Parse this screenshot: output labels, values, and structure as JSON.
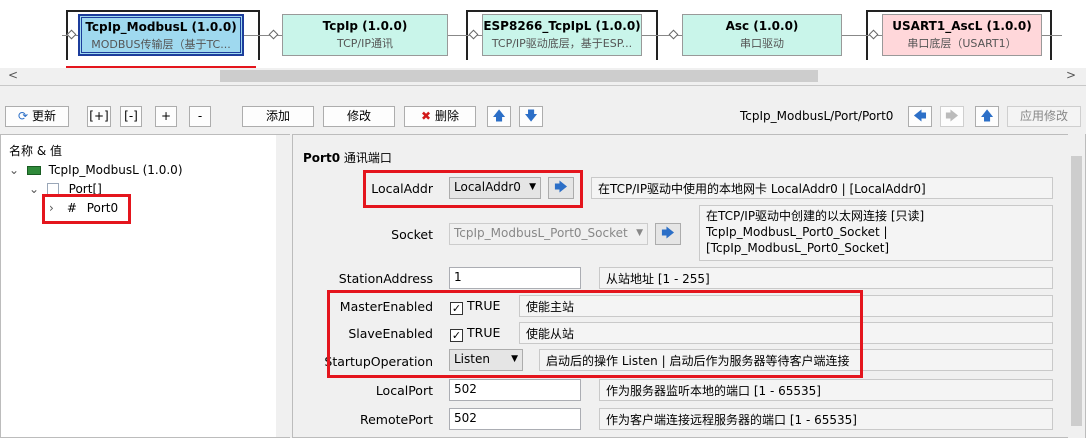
{
  "chain": {
    "nodes": [
      {
        "title": "TcpIp_ModbusL (1.0.0)",
        "sub": "MODBUS传输层（基于TC..."
      },
      {
        "title": "TcpIp (1.0.0)",
        "sub": "TCP/IP通讯"
      },
      {
        "title": "ESP8266_TcpIpL (1.0.0)",
        "sub": "TCP/IP驱动底层，基于ESP..."
      },
      {
        "title": "Asc (1.0.0)",
        "sub": "串口驱动"
      },
      {
        "title": "USART1_AscL (1.0.0)",
        "sub": "串口底层（USART1）"
      }
    ],
    "scroll_left": "<",
    "scroll_right": ">"
  },
  "toolbar": {
    "refresh": "更新",
    "expand": "[+]",
    "collapse": "[-]",
    "plus": "+",
    "minus": "-",
    "add": "添加",
    "modify": "修改",
    "delete": "删除",
    "path": "TcpIp_ModbusL/Port/Port0",
    "apply": "应用修改"
  },
  "tree": {
    "header": "名称 & 值",
    "root": "TcpIp_ModbusL (1.0.0)",
    "port": "Port[]",
    "port0": "Port0"
  },
  "panel": {
    "title_bold": "Port0",
    "title_rest": "通讯端口",
    "local_addr": {
      "label": "LocalAddr",
      "value": "LocalAddr0",
      "desc": "在TCP/IP驱动中使用的本地网卡 LocalAddr0 | [LocalAddr0]"
    },
    "socket": {
      "label": "Socket",
      "value": "TcpIp_ModbusL_Port0_Socket",
      "desc1": "在TCP/IP驱动中创建的以太网连接 [只读]",
      "desc2": "TcpIp_ModbusL_Port0_Socket |",
      "desc3": "[TcpIp_ModbusL_Port0_Socket]"
    },
    "station": {
      "label": "StationAddress",
      "value": "1",
      "desc": "从站地址 [1 - 255]"
    },
    "master": {
      "label": "MasterEnabled",
      "value": "TRUE",
      "desc": "使能主站"
    },
    "slave": {
      "label": "SlaveEnabled",
      "value": "TRUE",
      "desc": "使能从站"
    },
    "startup": {
      "label": "StartupOperation",
      "value": "Listen",
      "desc": "启动后的操作 Listen | 启动后作为服务器等待客户端连接"
    },
    "local_port": {
      "label": "LocalPort",
      "value": "502",
      "desc": "作为服务器监听本地的端口 [1 - 65535]"
    },
    "remote_port": {
      "label": "RemotePort",
      "value": "502",
      "desc": "作为客户端连接远程服务器的端口 [1 - 65535]"
    }
  },
  "colors": {
    "highlight": "#e4151d",
    "node_selected": "#9fd9ef",
    "node_teal": "#c9f5ea",
    "node_pink": "#ffd7da"
  }
}
